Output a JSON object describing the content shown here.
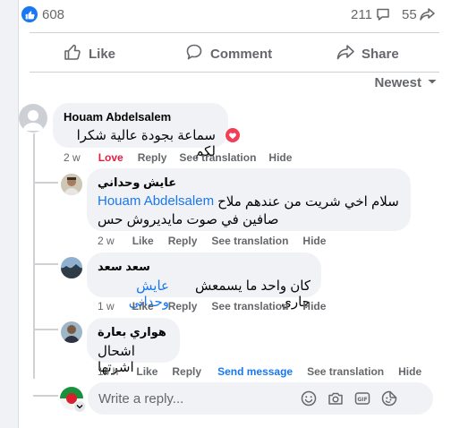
{
  "stats": {
    "likes": "608",
    "comments": "211",
    "shares": "55"
  },
  "actions": {
    "like": "Like",
    "comment": "Comment",
    "share": "Share"
  },
  "sort": {
    "label": "Newest"
  },
  "comments": [
    {
      "author": "Houam Abdelsalem",
      "text": "سماعة بجودة عالية شكرا لكم",
      "time": "2 w",
      "reaction_label": "Love",
      "reply_label": "Reply",
      "translate_label": "See translation",
      "hide_label": "Hide"
    }
  ],
  "replies": [
    {
      "author": "عايش وحداني",
      "mention": "Houam Abdelsalem",
      "text_line1": "سلام اخي شريت من عندهم ملاح",
      "text_line2": "صافين في صوت مايديروش حس",
      "time": "2 w",
      "like_label": "Like",
      "reply_label": "Reply",
      "translate_label": "See translation",
      "hide_label": "Hide"
    },
    {
      "author": "سعد سعد",
      "mention": "عايش وحداني",
      "text": "كان واحد ما يسمعش جاري",
      "time": "1 w",
      "like_label": "Like",
      "reply_label": "Reply",
      "translate_label": "See translation",
      "hide_label": "Hide"
    },
    {
      "author": "هواري بعارة",
      "text": "اشحال اشرتها",
      "time": "14 h",
      "like_label": "Like",
      "reply_label": "Reply",
      "message_label": "Send message",
      "translate_label": "See translation",
      "hide_label": "Hide"
    }
  ],
  "reply_box": {
    "placeholder": "Write a reply..."
  },
  "icons": {
    "like_badge": "thumbs-up-icon",
    "comment_count": "speech-bubble-icon",
    "share_count": "share-arrow-icon",
    "love_reaction": "heart-icon",
    "reply_tools": [
      "emoji-icon",
      "camera-icon",
      "gif-icon",
      "sticker-icon"
    ]
  },
  "colors": {
    "accent": "#1877f2",
    "love": "#e41e3f",
    "muted": "#65676b",
    "bubble": "#f0f2f5"
  }
}
